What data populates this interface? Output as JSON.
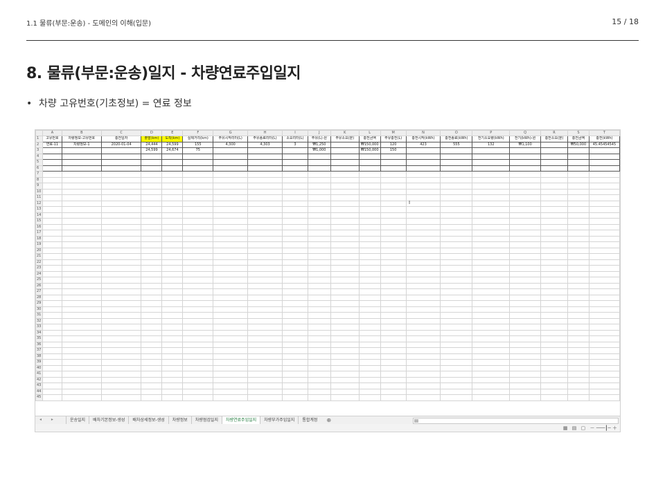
{
  "header": {
    "breadcrumb": "1.1 물류(부문:운송) - 도메인의 이해(입문)",
    "page_number": "15 / 18"
  },
  "slide": {
    "title": "8. 물류(부문:운송)일지 - 차량연료주입일지",
    "bullet_marker": "•",
    "bullet": "차량 고유번호(기초정보) = 연료 정보"
  },
  "spreadsheet": {
    "columns": [
      "A",
      "B",
      "C",
      "D",
      "E",
      "F",
      "G",
      "H",
      "I",
      "J",
      "K",
      "L",
      "M",
      "N",
      "O",
      "P",
      "Q",
      "R",
      "S",
      "T"
    ],
    "headers": [
      "고유번호",
      "차량정보-고유번호",
      "충전일자",
      "출발(km)",
      "도착(km)",
      "실제거리(km)",
      "주유시작리터(L)",
      "주유종료리터(L)",
      "소요리터(L)",
      "주유(L)-원",
      "주유소요(분)",
      "충전금액",
      "주유충전(L)",
      "충전시작(kWh)",
      "충전종료(kWh)",
      "전기소요량(kWh)",
      "전기(kWh)-원",
      "충전소요(분)",
      "충전금액",
      "충전(kWh)"
    ],
    "rows": [
      [
        "연료-11",
        "차량정보-1",
        "2020-01-04",
        "24,444",
        "24,599",
        "155",
        "4,300",
        "4,303",
        "3",
        "₩1,250",
        "",
        "₩150,000",
        "120",
        "423",
        "555",
        "132",
        "₩1,100",
        "",
        "₩50,000",
        "45.45454545"
      ],
      [
        "",
        "",
        "",
        "24,599",
        "24,674",
        "75",
        "",
        "",
        "",
        "₩1,000",
        "",
        "₩150,000",
        "150",
        "",
        "",
        "",
        "",
        "",
        "",
        ""
      ]
    ],
    "total_rows": 45,
    "highlight_color": "#ffff00"
  },
  "sheet_tabs": {
    "tabs": [
      "운송일지",
      "배차기본정보-생성",
      "배차상세정보-생성",
      "차량정보",
      "차량점검일지",
      "차량연료주입일지",
      "차량부가주입일지",
      "통합계정"
    ],
    "active_index": 5,
    "add_icon": "plus-circle-icon",
    "active_color": "#1e7b3b"
  }
}
